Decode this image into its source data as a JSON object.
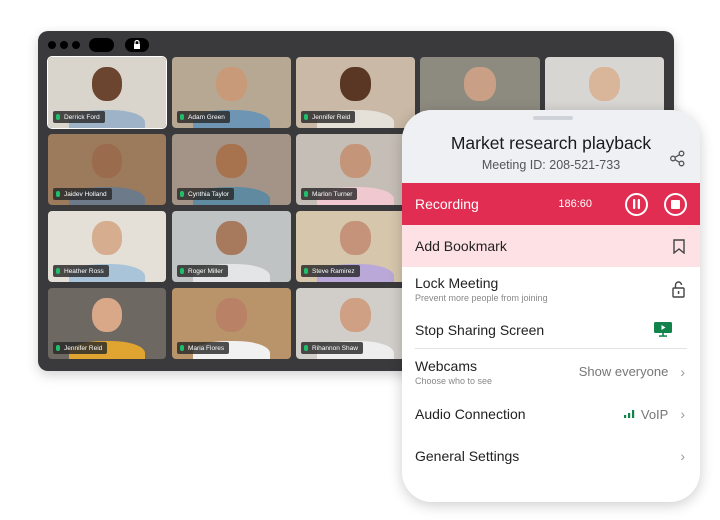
{
  "video_window": {
    "participants": [
      {
        "name": "Derrick Ford",
        "active": true
      },
      {
        "name": "Adam Green"
      },
      {
        "name": "Jennifer Reid"
      },
      {
        "name": ""
      },
      {
        "name": ""
      },
      {
        "name": "Jaidev Holland"
      },
      {
        "name": "Cynthia Taylor"
      },
      {
        "name": "Marlon Turner"
      },
      {
        "name": "Heather Ross"
      },
      {
        "name": "Roger Miller"
      },
      {
        "name": "Steve Ramirez"
      },
      {
        "name": "Jennifer Reid"
      },
      {
        "name": "Maria Flores"
      },
      {
        "name": "Rihannon Shaw"
      }
    ],
    "mic_color": "#1fbf6a"
  },
  "panel": {
    "title": "Market research playback",
    "meeting_id": "Meeting ID: 208-521-733",
    "recording": {
      "label": "Recording",
      "time": "186:60",
      "color": "#e12d52"
    },
    "bookmark": {
      "label": "Add Bookmark"
    },
    "lock": {
      "label": "Lock Meeting",
      "sub": "Prevent more people from joining"
    },
    "share_screen": {
      "label": "Stop Sharing Screen",
      "icon_color": "#12834a"
    },
    "webcams": {
      "label": "Webcams",
      "sub": "Choose who to see",
      "value": "Show everyone"
    },
    "audio": {
      "label": "Audio Connection",
      "value": "VoIP"
    },
    "settings": {
      "label": "General Settings"
    }
  }
}
